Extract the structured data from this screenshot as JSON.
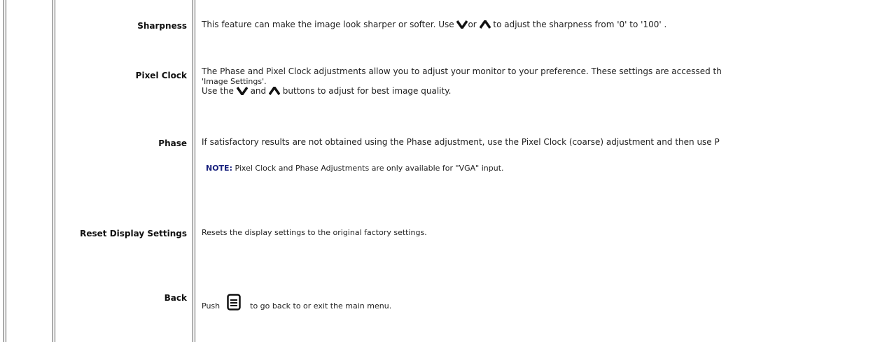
{
  "rows": {
    "sharpness": {
      "label": "Sharpness",
      "text_a": "This feature can make the image look sharper or softer. Use ",
      "text_b": "or ",
      "text_c": " to adjust the sharpness from '0' to '100' ."
    },
    "pixel_clock": {
      "label": "Pixel Clock",
      "line1": "The Phase and Pixel Clock adjustments allow you to adjust your monitor to your preference. These settings are accessed th",
      "line2": "'Image Settings'.",
      "line3_a": "Use the ",
      "line3_b": " and ",
      "line3_c": " buttons to adjust for best image quality."
    },
    "phase": {
      "label": "Phase",
      "text": "If satisfactory results are not obtained using the Phase adjustment, use the Pixel Clock (coarse) adjustment and then use P",
      "note_label": "NOTE:",
      "note_text": " Pixel Clock and Phase Adjustments are only available for \"VGA\" input."
    },
    "reset": {
      "label": "Reset Display Settings",
      "text": "Resets the display settings to the original factory settings."
    },
    "back": {
      "label": "Back",
      "text_a": "Push",
      "text_b": "to go back to or exit the main menu."
    }
  },
  "icons": {
    "down": "chevron-down-icon",
    "up": "chevron-up-icon",
    "menu": "menu-button-icon"
  }
}
